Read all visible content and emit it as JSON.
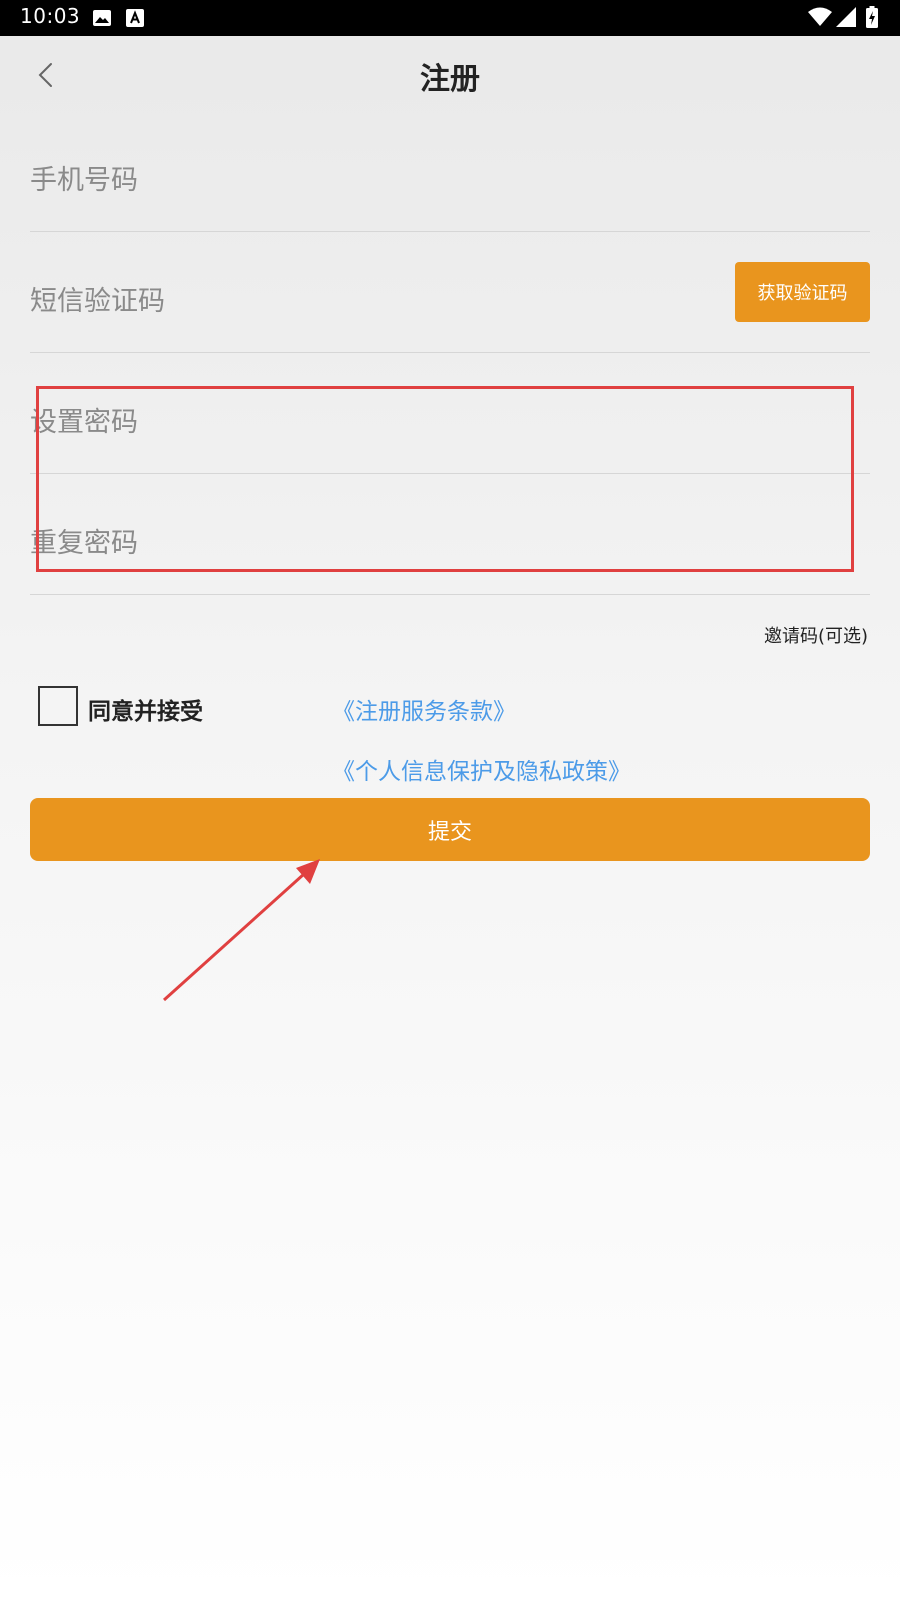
{
  "status_bar": {
    "time": "10:03",
    "icons": [
      "image-icon",
      "a-notification-icon",
      "wifi-icon",
      "signal-icon",
      "battery-icon"
    ]
  },
  "header": {
    "title": "注册",
    "back_icon": "chevron-left-icon"
  },
  "form": {
    "phone": {
      "placeholder": "手机号码"
    },
    "sms_code": {
      "placeholder": "短信验证码",
      "button": "获取验证码"
    },
    "password": {
      "placeholder": "设置密码"
    },
    "repeat_password": {
      "placeholder": "重复密码"
    },
    "invite_code_link": "邀请码(可选)"
  },
  "agreement": {
    "label": "同意并接受",
    "checked": false,
    "terms_link": "《注册服务条款》",
    "privacy_link": "《个人信息保护及隐私政策》"
  },
  "submit": {
    "label": "提交"
  },
  "colors": {
    "accent": "#e9951e",
    "link": "#4c9be8",
    "annotation": "#e04040"
  }
}
